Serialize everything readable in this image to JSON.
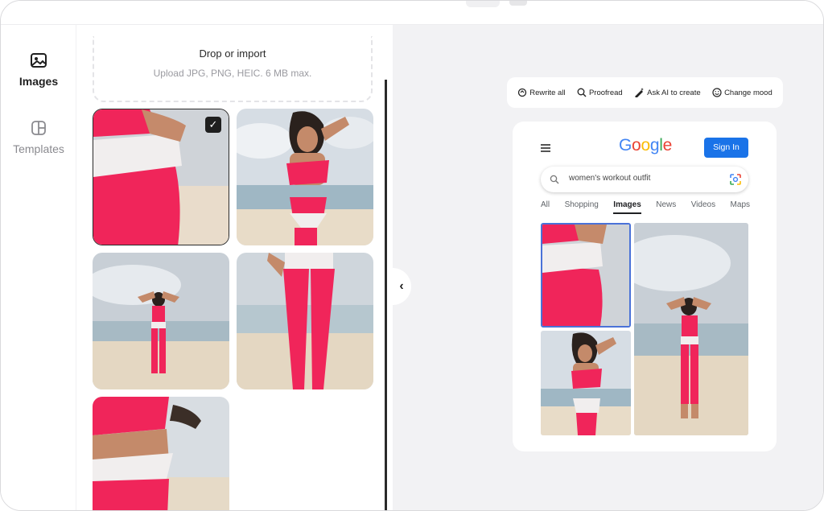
{
  "sidebar": {
    "items": [
      {
        "label": "Images",
        "icon": "image-icon",
        "active": true
      },
      {
        "label": "Templates",
        "icon": "template-icon",
        "active": false
      }
    ]
  },
  "upload": {
    "title": "Drop or import",
    "subtitle": "Upload JPG, PNG, HEIC. 6 MB max."
  },
  "toolbar": {
    "items": [
      {
        "label": "Rewrite all",
        "icon": "rewrite-icon"
      },
      {
        "label": "Proofread",
        "icon": "proofread-icon"
      },
      {
        "label": "Ask AI to create",
        "icon": "ai-create-icon"
      },
      {
        "label": "Change mood",
        "icon": "smiley-icon"
      }
    ]
  },
  "preview": {
    "logo": "Google",
    "signin_label": "Sign In",
    "search_query": "women's workout outfit",
    "tabs": [
      "All",
      "Shopping",
      "Images",
      "News",
      "Videos",
      "Maps"
    ],
    "active_tab": "Images"
  },
  "colors": {
    "outfit_pink": "#f0255a",
    "accent_blue": "#1a73e8",
    "highlight_border": "#4a72d8",
    "panel_bg": "#f2f2f4"
  }
}
